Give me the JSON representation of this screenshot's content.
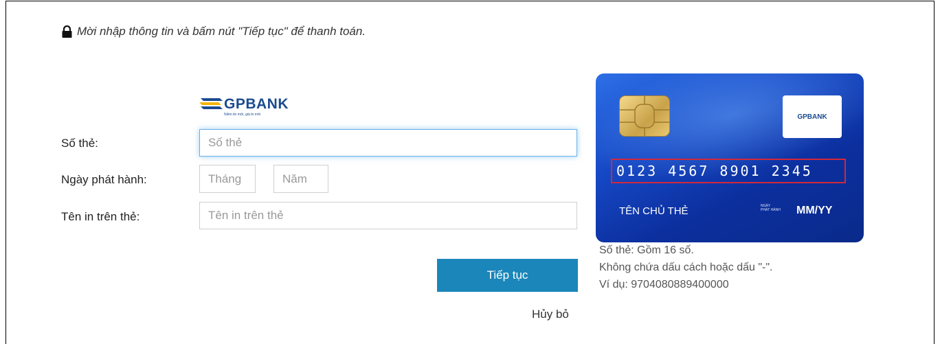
{
  "notice": {
    "text": "Mời nhập thông tin và bấm nút \"Tiếp tục\" để thanh toán.",
    "icon": "lock-icon"
  },
  "bank_logo": {
    "name": "GPBANK",
    "slogan": "Niềm tin mới, giá trị mới",
    "color": "#1b4b8f"
  },
  "form": {
    "card_number": {
      "label": "Số thẻ:",
      "placeholder": "Số thẻ"
    },
    "issue_date": {
      "label": "Ngày phát hành:",
      "month_placeholder": "Tháng",
      "year_placeholder": "Năm"
    },
    "card_name": {
      "label": "Tên in trên thẻ:",
      "placeholder": "Tên in trên thẻ"
    },
    "continue_label": "Tiếp tục",
    "cancel_label": "Hủy bỏ",
    "accent_color": "#1a86b9"
  },
  "card_sample": {
    "number": "0123 4567 8901 2345",
    "holder": "TÊN CHỦ THẺ",
    "issue_small_1": "NGÀY",
    "issue_small_2": "PHÁT HÀNH",
    "date": "MM/YY",
    "logo_text": "GPBANK"
  },
  "hints": {
    "line1": "Số thẻ: Gồm 16 số.",
    "line2": "Không chứa dấu cách hoặc dấu \"-\".",
    "line3": "Ví dụ: 9704080889400000"
  }
}
